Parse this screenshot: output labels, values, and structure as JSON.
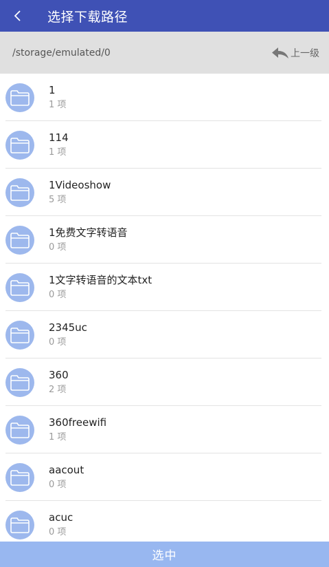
{
  "header": {
    "title": "选择下载路径"
  },
  "pathbar": {
    "path": "/storage/emulated/0",
    "up_label": "上一级"
  },
  "folders": [
    {
      "name": "1",
      "count": "1 项"
    },
    {
      "name": "114",
      "count": "1 项"
    },
    {
      "name": "1Videoshow",
      "count": "5 项"
    },
    {
      "name": "1免费文字转语音",
      "count": "0 项"
    },
    {
      "name": "1文字转语音的文本txt",
      "count": "0 项"
    },
    {
      "name": "2345uc",
      "count": "0 项"
    },
    {
      "name": "360",
      "count": "2 项"
    },
    {
      "name": "360freewifi",
      "count": "1 项"
    },
    {
      "name": "aacout",
      "count": "0 项"
    },
    {
      "name": "acuc",
      "count": "0 项"
    }
  ],
  "footer": {
    "select_label": "选中"
  },
  "colors": {
    "appbar": "#3f51b5",
    "folder_icon_bg": "#9db8ed",
    "select_button": "#98b7f0",
    "pathbar": "#e0e0e0"
  }
}
